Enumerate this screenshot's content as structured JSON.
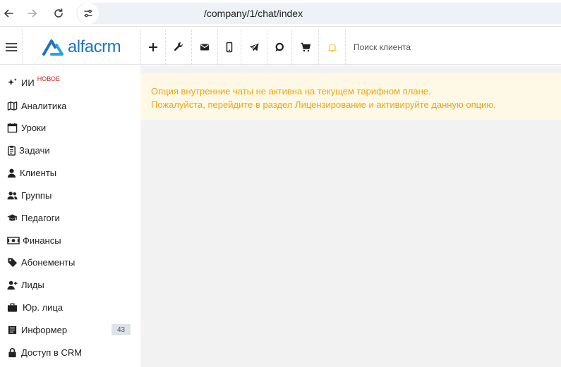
{
  "browser": {
    "url": "/company/1/chat/index"
  },
  "header": {
    "logo_text": "alfacrm",
    "search_placeholder": "Поиск клиента",
    "actions": [
      {
        "name": "add-button",
        "icon": "plus-icon"
      },
      {
        "name": "settings-button",
        "icon": "wrench-icon"
      },
      {
        "name": "mail-button",
        "icon": "envelope-icon"
      },
      {
        "name": "mobile-button",
        "icon": "phone-icon"
      },
      {
        "name": "telegram-button",
        "icon": "telegram-icon"
      },
      {
        "name": "chat-button",
        "icon": "chat-bubble-icon"
      },
      {
        "name": "cart-button",
        "icon": "cart-icon"
      },
      {
        "name": "notifications-button",
        "icon": "bell-icon"
      }
    ],
    "bell_color": "#f7c948",
    "logo_color": "#1b73c4"
  },
  "sidebar": {
    "items": [
      {
        "label": "ИИ",
        "badge": "НОВОЕ",
        "icon": "sparkles-icon"
      },
      {
        "label": "Аналитика",
        "icon": "map-icon"
      },
      {
        "label": "Уроки",
        "icon": "calendar-icon"
      },
      {
        "label": "Задачи",
        "icon": "clipboard-icon"
      },
      {
        "label": "Клиенты",
        "icon": "user-icon"
      },
      {
        "label": "Группы",
        "icon": "users-icon"
      },
      {
        "label": "Педагоги",
        "icon": "graduation-cap-icon"
      },
      {
        "label": "Финансы",
        "icon": "money-icon"
      },
      {
        "label": "Абонементы",
        "icon": "tag-icon"
      },
      {
        "label": "Лиды",
        "icon": "user-plus-icon"
      },
      {
        "label": "Юр. лица",
        "icon": "briefcase-icon"
      },
      {
        "label": "Информер",
        "count": "43",
        "icon": "newspaper-icon"
      },
      {
        "label": "Доступ в CRM",
        "icon": "lock-icon"
      }
    ]
  },
  "alert": {
    "line1": "Опция внутренние чаты не активна на текущем тарифном плане.",
    "line2": "Пожалуйста, перейдите в раздел Лицензирование и активируйте данную опцию.",
    "text_color": "#f0a30a",
    "bg_color": "#fdf9e6"
  }
}
